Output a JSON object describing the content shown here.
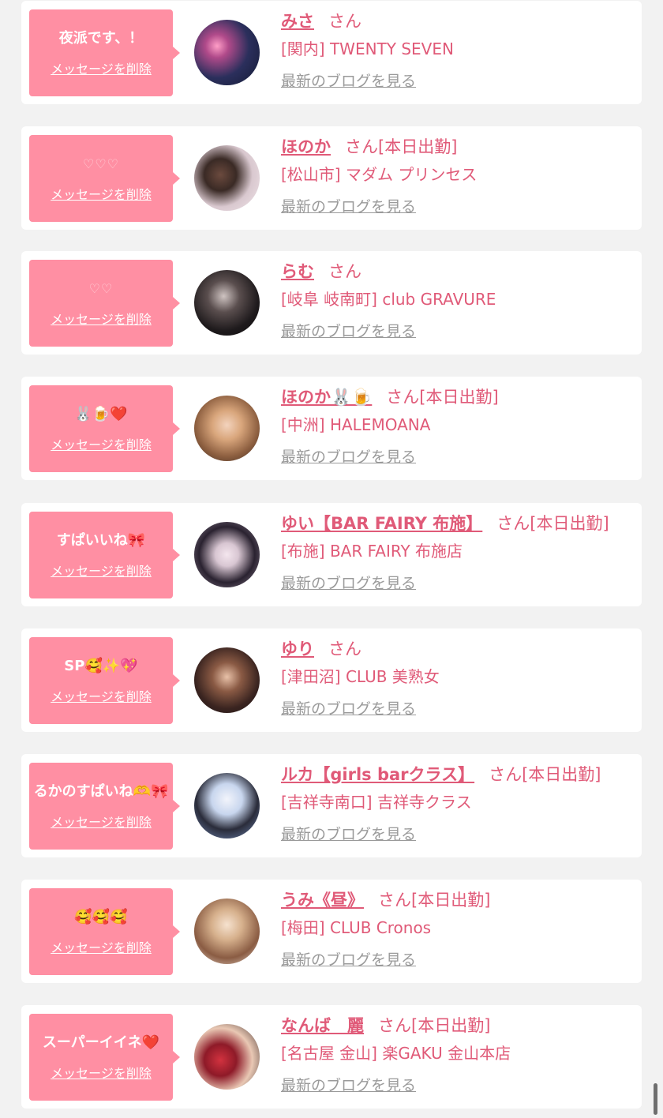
{
  "delete_label": "メッセージを削除",
  "blog_label": "最新のブログを見る",
  "honorific": "さん",
  "colors": {
    "accent": "#e05a78",
    "bubble": "#ff8fa3",
    "background": "#f2f2f2",
    "link_gray": "#9a9a9a"
  },
  "cards": [
    {
      "message": "夜派です、！",
      "name": "みさ",
      "status": "",
      "shop": "[関内] TWENTY SEVEN",
      "avatar_icon": "avatar-photo-night-lights"
    },
    {
      "message": "♡♡♡",
      "name": "ほのか",
      "status": "[本日出勤]",
      "shop": "[松山市] マダム プリンセス",
      "avatar_icon": "avatar-photo-hair"
    },
    {
      "message": "♡♡",
      "name": "らむ",
      "status": "",
      "shop": "[岐阜 岐南町] club GRAVURE",
      "avatar_icon": "avatar-photo-dark"
    },
    {
      "message": "🐰🍺❤️",
      "name": "ほのか🐰🍺",
      "status": "[本日出勤]",
      "shop": "[中洲] HALEMOANA",
      "avatar_icon": "avatar-photo-blonde"
    },
    {
      "message": "すぱいいね🎀",
      "name": "ゆい【BAR FAIRY 布施】",
      "status": "[本日出勤]",
      "shop": "[布施] BAR FAIRY 布施店",
      "avatar_icon": "avatar-photo-black-hair"
    },
    {
      "message": "SP🥰✨💖",
      "name": "ゆり",
      "status": "",
      "shop": "[津田沼] CLUB 美熟女",
      "avatar_icon": "avatar-photo-warm"
    },
    {
      "message": "るかのすぱいね🫶🎀",
      "name": "ルカ【girls barクラス】",
      "status": "[本日出勤]",
      "shop": "[吉祥寺南口] 吉祥寺クラス",
      "avatar_icon": "avatar-photo-blue"
    },
    {
      "message": "🥰🥰🥰",
      "name": "うみ《昼》",
      "status": "[本日出勤]",
      "shop": "[梅田] CLUB Cronos",
      "avatar_icon": "avatar-photo-beige"
    },
    {
      "message": "スーパーイイネ❤️",
      "name": "なんば　麗",
      "status": "[本日出勤]",
      "shop": "[名古屋 金山] 楽GAKU 金山本店",
      "avatar_icon": "avatar-photo-roses"
    }
  ]
}
